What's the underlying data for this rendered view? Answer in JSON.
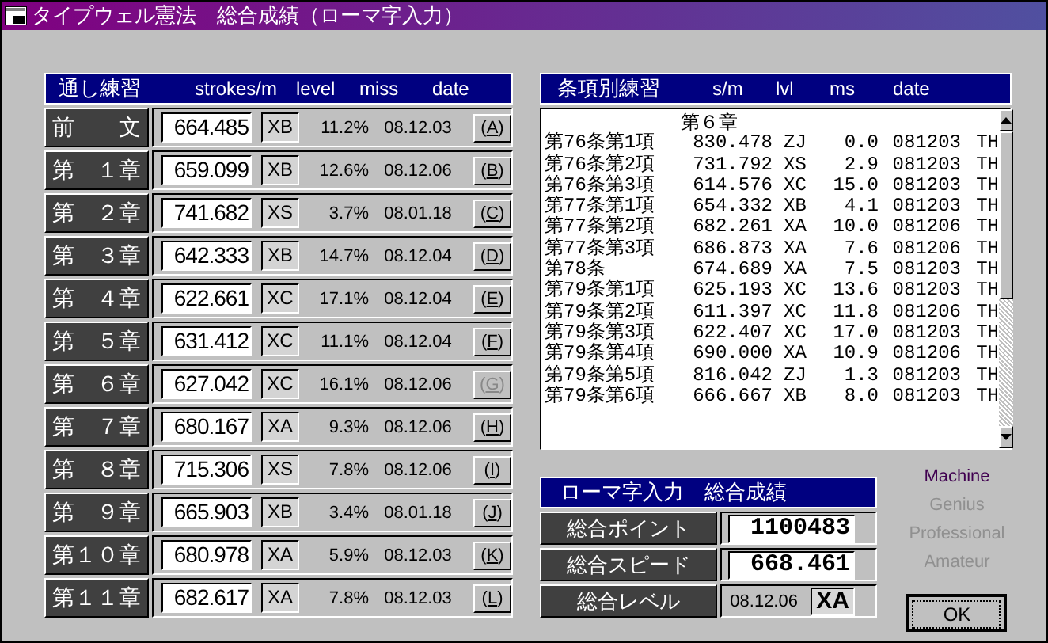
{
  "window": {
    "title": "タイプウェル憲法　総合成績（ローマ字入力）"
  },
  "chapters": {
    "columns": [
      "通し練習",
      "strokes/m",
      "level",
      "miss",
      "date"
    ],
    "rows": [
      {
        "label": "前　　文",
        "speed": "664.485",
        "level": "XB",
        "miss": "11.2%",
        "date": "08.12.03",
        "button": "(A)",
        "disabled": false
      },
      {
        "label": "第　１章",
        "speed": "659.099",
        "level": "XB",
        "miss": "12.6%",
        "date": "08.12.06",
        "button": "(B)",
        "disabled": false
      },
      {
        "label": "第　２章",
        "speed": "741.682",
        "level": "XS",
        "miss": "3.7%",
        "date": "08.01.18",
        "button": "(C)",
        "disabled": false
      },
      {
        "label": "第　３章",
        "speed": "642.333",
        "level": "XB",
        "miss": "14.7%",
        "date": "08.12.04",
        "button": "(D)",
        "disabled": false
      },
      {
        "label": "第　４章",
        "speed": "622.661",
        "level": "XC",
        "miss": "17.1%",
        "date": "08.12.04",
        "button": "(E)",
        "disabled": false
      },
      {
        "label": "第　５章",
        "speed": "631.412",
        "level": "XC",
        "miss": "11.1%",
        "date": "08.12.04",
        "button": "(F)",
        "disabled": false
      },
      {
        "label": "第　６章",
        "speed": "627.042",
        "level": "XC",
        "miss": "16.1%",
        "date": "08.12.06",
        "button": "(G)",
        "disabled": true
      },
      {
        "label": "第　７章",
        "speed": "680.167",
        "level": "XA",
        "miss": "9.3%",
        "date": "08.12.06",
        "button": "(H)",
        "disabled": false
      },
      {
        "label": "第　８章",
        "speed": "715.306",
        "level": "XS",
        "miss": "7.8%",
        "date": "08.12.06",
        "button": "(I)",
        "disabled": false
      },
      {
        "label": "第　９章",
        "speed": "665.903",
        "level": "XB",
        "miss": "3.4%",
        "date": "08.01.18",
        "button": "(J)",
        "disabled": false
      },
      {
        "label": "第１０章",
        "speed": "680.978",
        "level": "XA",
        "miss": "5.9%",
        "date": "08.12.03",
        "button": "(K)",
        "disabled": false
      },
      {
        "label": "第１１章",
        "speed": "682.617",
        "level": "XA",
        "miss": "7.8%",
        "date": "08.12.03",
        "button": "(L)",
        "disabled": false
      }
    ]
  },
  "articles": {
    "columns": [
      "条項別練習",
      "s/m",
      "lvl",
      "ms",
      "date"
    ],
    "rows": [
      {
        "kind": "heading",
        "title": "第６章"
      },
      {
        "kind": "entry",
        "name": "第76条第1項",
        "sm": "830.478",
        "lvl": "ZJ",
        "ms": "0.0",
        "date": "081203",
        "who": "TH"
      },
      {
        "kind": "entry",
        "name": "第76条第2項",
        "sm": "731.792",
        "lvl": "XS",
        "ms": "2.9",
        "date": "081203",
        "who": "TH"
      },
      {
        "kind": "entry",
        "name": "第76条第3項",
        "sm": "614.576",
        "lvl": "XC",
        "ms": "15.0",
        "date": "081203",
        "who": "TH"
      },
      {
        "kind": "entry",
        "name": "第77条第1項",
        "sm": "654.332",
        "lvl": "XB",
        "ms": "4.1",
        "date": "081203",
        "who": "TH"
      },
      {
        "kind": "entry",
        "name": "第77条第2項",
        "sm": "682.261",
        "lvl": "XA",
        "ms": "10.0",
        "date": "081206",
        "who": "TH"
      },
      {
        "kind": "entry",
        "name": "第77条第3項",
        "sm": "686.873",
        "lvl": "XA",
        "ms": "7.6",
        "date": "081206",
        "who": "TH"
      },
      {
        "kind": "entry",
        "name": "第78条",
        "sm": "674.689",
        "lvl": "XA",
        "ms": "7.5",
        "date": "081203",
        "who": "TH"
      },
      {
        "kind": "entry",
        "name": "第79条第1項",
        "sm": "625.193",
        "lvl": "XC",
        "ms": "13.6",
        "date": "081203",
        "who": "TH"
      },
      {
        "kind": "entry",
        "name": "第79条第2項",
        "sm": "611.397",
        "lvl": "XC",
        "ms": "11.8",
        "date": "081206",
        "who": "TH"
      },
      {
        "kind": "entry",
        "name": "第79条第3項",
        "sm": "622.407",
        "lvl": "XC",
        "ms": "17.0",
        "date": "081203",
        "who": "TH"
      },
      {
        "kind": "entry",
        "name": "第79条第4項",
        "sm": "690.000",
        "lvl": "XA",
        "ms": "10.9",
        "date": "081206",
        "who": "TH"
      },
      {
        "kind": "entry",
        "name": "第79条第5項",
        "sm": "816.042",
        "lvl": "ZJ",
        "ms": "1.3",
        "date": "081203",
        "who": "TH"
      },
      {
        "kind": "entry",
        "name": "第79条第6項",
        "sm": "666.667",
        "lvl": "XB",
        "ms": "8.0",
        "date": "081203",
        "who": "TH"
      }
    ]
  },
  "summary": {
    "title": "ローマ字入力　総合成績",
    "points_label": "総合ポイント",
    "points": "1100483",
    "speed_label": "総合スピード",
    "speed": "668.461",
    "level_label": "総合レベル",
    "level_date": "08.12.06",
    "level": "XA"
  },
  "ranks": [
    {
      "label": "Machine",
      "selected": true
    },
    {
      "label": "Genius",
      "selected": false
    },
    {
      "label": "Professional",
      "selected": false
    },
    {
      "label": "Amateur",
      "selected": false
    }
  ],
  "ok_button": "OK"
}
